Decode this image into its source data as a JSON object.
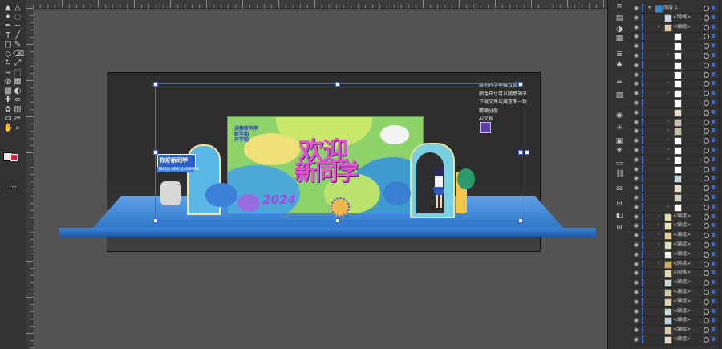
{
  "layers_panel": {
    "rows": [
      {
        "name": "图层 1",
        "indent": 0,
        "arrow": "▾",
        "thumb": "#2a8cd8"
      },
      {
        "name": "<网格>",
        "indent": 1,
        "arrow": "",
        "thumb": "#c9d8f0"
      },
      {
        "name": "<编组>",
        "indent": 1,
        "arrow": "▾",
        "thumb": "#e8c8a8"
      },
      {
        "name": "",
        "indent": 2,
        "arrow": "",
        "thumb": "#ffffff"
      },
      {
        "name": "",
        "indent": 2,
        "arrow": "",
        "thumb": "#ffffff"
      },
      {
        "name": "",
        "indent": 2,
        "arrow": "›",
        "thumb": "#ffffff"
      },
      {
        "name": "",
        "indent": 2,
        "arrow": "",
        "thumb": "#ffffff"
      },
      {
        "name": "",
        "indent": 2,
        "arrow": "",
        "thumb": "#ffffff"
      },
      {
        "name": "",
        "indent": 2,
        "arrow": "›",
        "thumb": "#ffffff"
      },
      {
        "name": "",
        "indent": 2,
        "arrow": "›",
        "thumb": "#ffffff"
      },
      {
        "name": "",
        "indent": 2,
        "arrow": "",
        "thumb": "#ffffff"
      },
      {
        "name": "",
        "indent": 2,
        "arrow": "",
        "thumb": "#e8e0c8"
      },
      {
        "name": "",
        "indent": 2,
        "arrow": "›",
        "thumb": "#c8c0a8"
      },
      {
        "name": "",
        "indent": 2,
        "arrow": "›",
        "thumb": "#c8c0a8"
      },
      {
        "name": "",
        "indent": 2,
        "arrow": "›",
        "thumb": "#ffffff"
      },
      {
        "name": "",
        "indent": 2,
        "arrow": "›",
        "thumb": "#ffffff"
      },
      {
        "name": "",
        "indent": 2,
        "arrow": "›",
        "thumb": "#ffffff"
      },
      {
        "name": "",
        "indent": 2,
        "arrow": "",
        "thumb": "#ffffff"
      },
      {
        "name": "",
        "indent": 2,
        "arrow": "",
        "thumb": "#c0d8e8"
      },
      {
        "name": "",
        "indent": 2,
        "arrow": "",
        "thumb": "#e8e0c8"
      },
      {
        "name": "",
        "indent": 2,
        "arrow": "",
        "thumb": "#d8d0b8"
      },
      {
        "name": "",
        "indent": 2,
        "arrow": "›",
        "thumb": "#ffffff"
      },
      {
        "name": "<编组>",
        "indent": 1,
        "arrow": "›",
        "thumb": "#e8d8a8"
      },
      {
        "name": "<编组>",
        "indent": 1,
        "arrow": "›",
        "thumb": "#f0e0b8"
      },
      {
        "name": "<编组>",
        "indent": 1,
        "arrow": "›",
        "thumb": "#e8c890"
      },
      {
        "name": "<编组>",
        "indent": 1,
        "arrow": "›",
        "thumb": "#d8e0c0"
      },
      {
        "name": "<编组>",
        "indent": 1,
        "arrow": "›",
        "thumb": "#f0f0e0"
      },
      {
        "name": "<网格>",
        "indent": 1,
        "arrow": "›",
        "thumb": "#d8a860"
      },
      {
        "name": "<网格>",
        "indent": 1,
        "arrow": "",
        "thumb": "#e8d8b0"
      },
      {
        "name": "<编组>",
        "indent": 1,
        "arrow": "",
        "thumb": "#c8d8c8"
      },
      {
        "name": "<编组>",
        "indent": 1,
        "arrow": "",
        "thumb": "#d8c8a0"
      },
      {
        "name": "<编组>",
        "indent": 1,
        "arrow": "",
        "thumb": "#e0d0b0"
      },
      {
        "name": "<编组>",
        "indent": 1,
        "arrow": "",
        "thumb": "#c8e0d8"
      },
      {
        "name": "<编组>",
        "indent": 1,
        "arrow": "",
        "thumb": "#b8d8e8"
      },
      {
        "name": "<编组>",
        "indent": 1,
        "arrow": "",
        "thumb": "#d8c8a8"
      },
      {
        "name": "<编组>",
        "indent": 1,
        "arrow": "",
        "thumb": "#e8d8b8"
      }
    ]
  },
  "artboard": {
    "notes": [
      "原创开学季舞台设计",
      "颜色尺寸可以随意调节",
      "下载文件与展览图一致",
      "精确分层",
      "AI文档"
    ],
    "title_line1": "欢迎",
    "title_line2": "新同学",
    "year": "2024",
    "board_lines": [
      "迎接新同学",
      "新学期",
      "开学啦"
    ],
    "sign_left": "你好新同学",
    "sign_left_sub": "HELLO, NEW CLASSMATE"
  },
  "colors": {
    "selection": "#3a6bd8",
    "floor": "#3d86d8",
    "board": "#8ed36a",
    "title": "#e84fd0"
  },
  "icons": {
    "tools": [
      "selection-tool-icon",
      "direct-selection-tool-icon",
      "magic-wand-icon",
      "lasso-icon",
      "pen-tool-icon",
      "curvature-tool-icon",
      "type-tool-icon",
      "line-tool-icon",
      "rectangle-tool-icon",
      "paintbrush-icon",
      "shaper-tool-icon",
      "eraser-icon",
      "rotate-tool-icon",
      "scale-tool-icon",
      "width-tool-icon",
      "free-transform-icon",
      "shape-builder-icon",
      "perspective-grid-icon",
      "mesh-tool-icon",
      "gradient-tool-icon",
      "eyedropper-icon",
      "blend-tool-icon",
      "symbol-sprayer-icon",
      "graph-tool-icon",
      "artboard-tool-icon",
      "slice-tool-icon",
      "hand-tool-icon",
      "zoom-tool-icon"
    ],
    "panels": [
      "properties-icon",
      "libraries-icon",
      "color-icon",
      "swatches-icon",
      "brushes-icon",
      "symbols-icon",
      "stroke-icon",
      "gradient-icon",
      "transparency-icon",
      "appearance-icon",
      "graphic-styles-icon",
      "layers-icon",
      "artboards-icon",
      "links-icon",
      "comments-icon",
      "align-icon",
      "pathfinder-icon",
      "transform-icon"
    ]
  }
}
